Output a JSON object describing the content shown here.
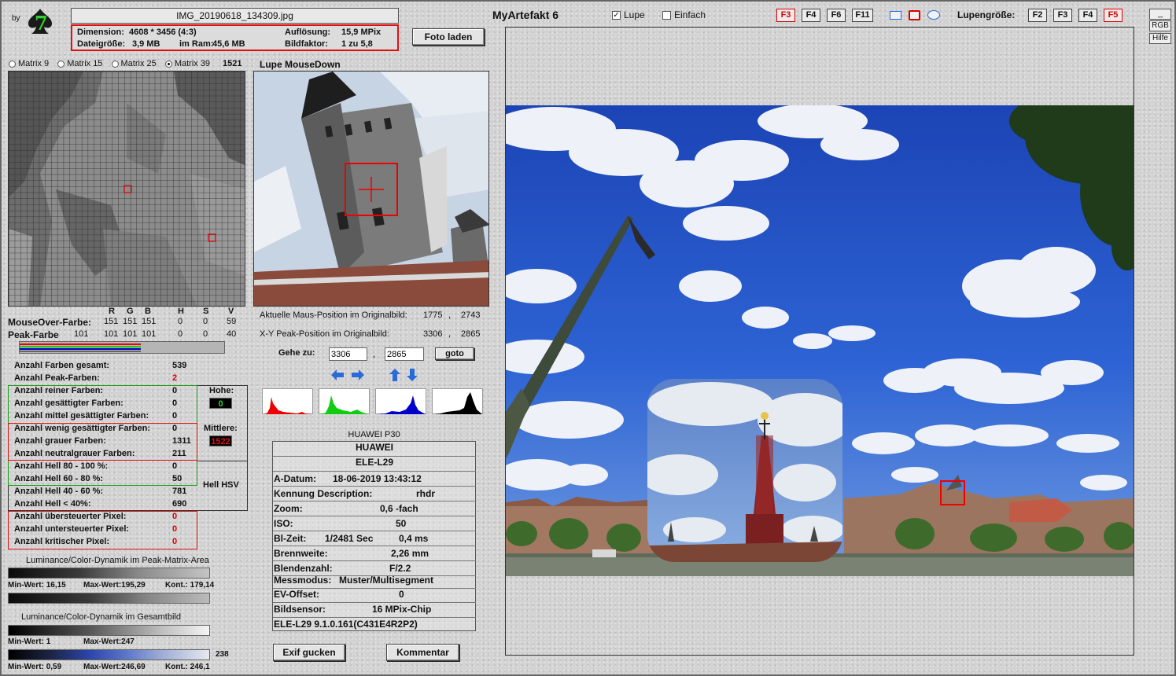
{
  "header": {
    "by": "by",
    "logo_glyph": "7",
    "filename": "IMG_20190618_134309.jpg",
    "dimension_label": "Dimension:",
    "dimension_value": "4608 * 3456 (4:3)",
    "resolution_label": "Auflösung:",
    "resolution_value": "15,9 MPix",
    "filesize_label": "Dateigröße:",
    "filesize_value": "3,9 MB",
    "ram_label": "im Ram:",
    "ram_value": "45,6 MB",
    "factor_label": "Bildfaktor:",
    "factor_value": "1 zu 5,8",
    "load_button": "Foto laden",
    "app_title": "MyArtefakt 6",
    "lupe_label": "Lupe",
    "einfach_label": "Einfach",
    "fkeys": [
      "F3",
      "F4",
      "F6",
      "F11"
    ],
    "lupengroesse_label": "Lupengröße:",
    "lupe_fkeys": [
      "F2",
      "F3",
      "F4",
      "F5"
    ],
    "rgb_label": "RGB",
    "hilfe_label": "Hilfe"
  },
  "matrix": {
    "options": [
      "Matrix 9",
      "Matrix 15",
      "Matrix 25",
      "Matrix 39"
    ],
    "selected": "Matrix 39",
    "count": "1521"
  },
  "lupe": {
    "title": "Lupe MouseDown",
    "mouse_pos_label": "Aktuelle Maus-Position  im Originalbild:",
    "mouse_x": "1775",
    "mouse_y": "2743",
    "peak_pos_label": "X-Y Peak-Position  im Originalbild:",
    "peak_x": "3306",
    "peak_y": "2865",
    "goto_label": "Gehe zu:",
    "goto_x": "3306",
    "goto_y": "2865",
    "goto_button": "goto",
    "comma": ","
  },
  "colors": {
    "headers": [
      "R",
      "G",
      "B",
      "H",
      "S",
      "V"
    ],
    "mouseover_label": "MouseOver-Farbe:",
    "mouseover_values": [
      "151",
      "151",
      "151",
      "0",
      "0",
      "59"
    ],
    "peak_label": "Peak-Farbe",
    "peak_values": [
      "101",
      "101",
      "101",
      "0",
      "0",
      "40"
    ]
  },
  "stats": {
    "total_colors_label": "Anzahl Farben gesamt:",
    "total_colors": "539",
    "peak_colors_label": "Anzahl Peak-Farben:",
    "peak_colors": "2",
    "pure_label": "Anzahl reiner Farben:",
    "pure": "0",
    "saturated_label": "Anzahl gesättigter Farben:",
    "saturated": "0",
    "mid_sat_label": "Anzahl mittel gesättigter Farben:",
    "mid_sat": "0",
    "low_sat_label": "Anzahl wenig gesättigter Farben:",
    "low_sat": "0",
    "gray_label": "Anzahl grauer Farben:",
    "gray": "1311",
    "neutral_gray_label": "Anzahl neutralgrauer Farben:",
    "neutral_gray": "211",
    "hell80_label": "Anzahl Hell 80 - 100 %:",
    "hell80": "0",
    "hell60_label": "Anzahl Hell 60 - 80 %:",
    "hell60": "50",
    "hell40_label": "Anzahl Hell 40 - 60 %:",
    "hell40": "781",
    "hell0_label": "Anzahl Hell < 40%:",
    "hell0": "690",
    "over_label": "Anzahl übersteuerter Pixel:",
    "over": "0",
    "under_label": "Anzahl untersteuerter Pixel:",
    "under": "0",
    "critical_label": "Anzahl kritischer Pixel:",
    "critical": "0",
    "hohe_label": "Hohe:",
    "hohe_value": "0",
    "mittlere_label": "Mittlere:",
    "mittlere_value": "1522",
    "hell_hsv_label": "Hell HSV"
  },
  "dynamics": {
    "peak_area_label": "Luminance/Color-Dynamik im Peak-Matrix-Area",
    "peak_min": "Min-Wert: 16,15",
    "peak_max": "Max-Wert:195,29",
    "peak_kont": "Kont.: 179,14",
    "whole_label": "Luminance/Color-Dynamik im Gesamtbild",
    "whole_min": "Min-Wert: 1",
    "whole_max": "Max-Wert:247",
    "ramp_value": "238",
    "color_min": "Min-Wert: 0,59",
    "color_max": "Max-Wert:246,69",
    "color_kont": "Kont.: 246,1"
  },
  "exif": {
    "camera": "HUAWEI P30",
    "make": "HUAWEI",
    "model": "ELE-L29",
    "date_label": "A-Datum:",
    "date_value": "18-06-2019 13:43:12",
    "kennung_label": "Kennung Description:",
    "kennung_value": "rhdr",
    "zoom_label": "Zoom:",
    "zoom_value": "0,6 -fach",
    "iso_label": "ISO:",
    "iso_value": "50",
    "bl_label": "Bl-Zeit:",
    "bl_value1": "1/2481 Sec",
    "bl_value2": "0,4 ms",
    "brenn_label": "Brennweite:",
    "brenn_value": "2,26  mm",
    "blende_label": "Blendenzahl:",
    "blende_value": "F/2.2",
    "mess_label": "Messmodus:",
    "mess_value": "Muster/Multisegment",
    "ev_label": "EV-Offset:",
    "ev_value": "0",
    "sensor_label": "Bildsensor:",
    "sensor_value": "16 MPix-Chip",
    "firmware": "ELE-L29 9.1.0.161(C431E4R2P2)",
    "exif_button": "Exif gucken",
    "comment_button": "Kommentar"
  }
}
